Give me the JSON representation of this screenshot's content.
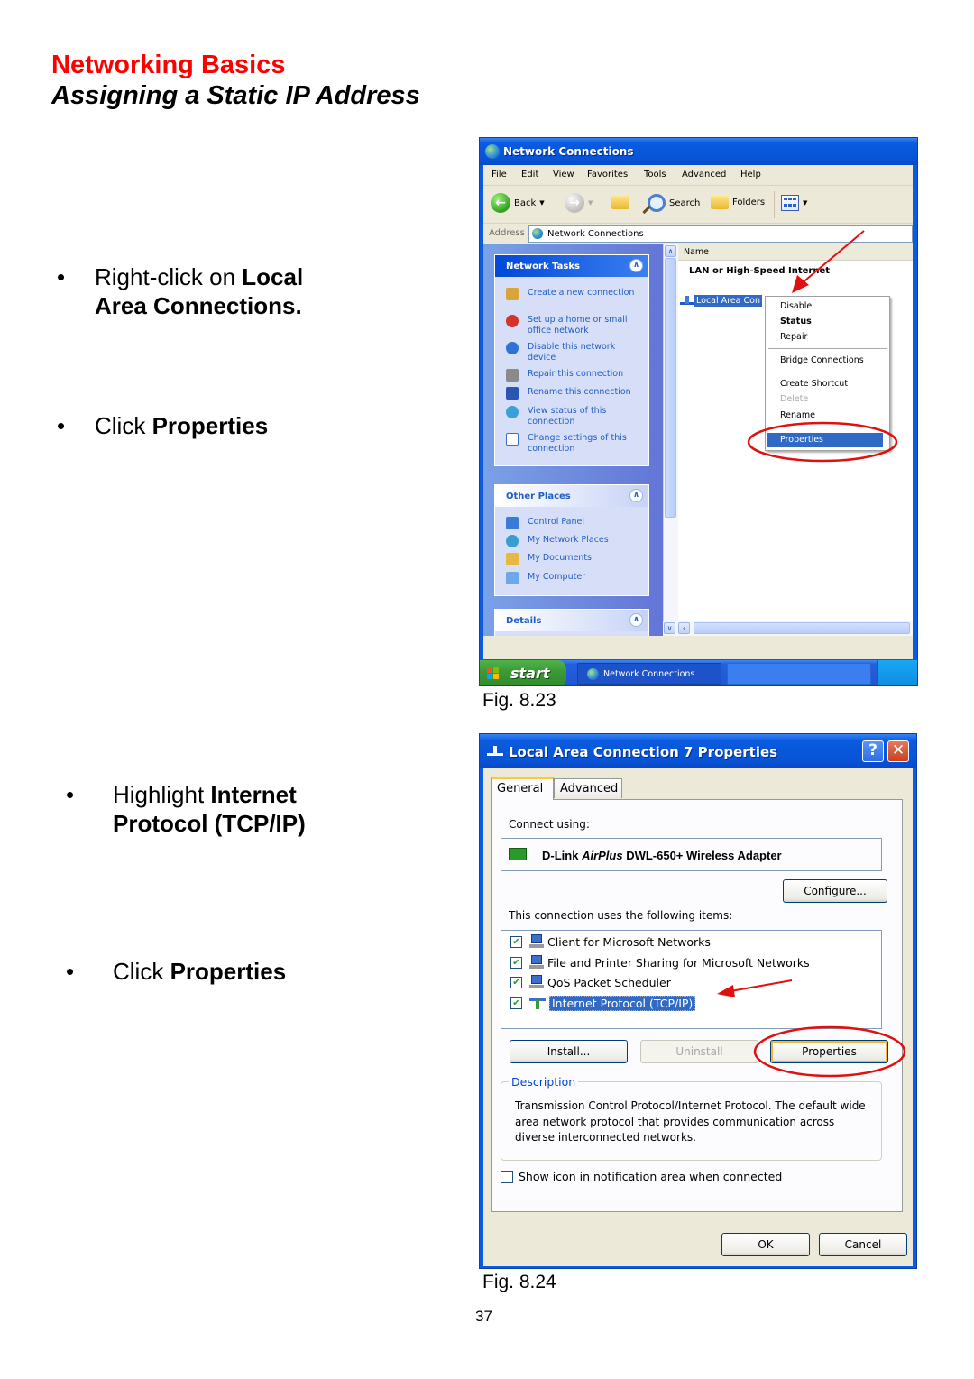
{
  "page": {
    "section": "Networking Basics",
    "title": "Assigning a Static IP Address",
    "page_number": "37",
    "accent_color": "#ff0000"
  },
  "instructions": {
    "step1": {
      "normal": "Right-click on ",
      "bold_a": "Local",
      "bold_b": "Area Connections."
    },
    "step2": {
      "normal": "Click ",
      "bold": "Properties"
    },
    "step3": {
      "normal": "Highlight ",
      "bold_a": "Internet",
      "bold_b": "Protocol (TCP/IP)"
    },
    "step4": {
      "normal": "Click ",
      "bold": "Properties"
    },
    "bullet": "•"
  },
  "fig1": {
    "caption": "Fig. 8.23",
    "window_title": "Network Connections",
    "menu": [
      "File",
      "Edit",
      "View",
      "Favorites",
      "Tools",
      "Advanced",
      "Help"
    ],
    "toolbar": {
      "back": "Back",
      "search": "Search",
      "folders": "Folders"
    },
    "address": {
      "label": "Address",
      "value": "Network Connections"
    },
    "network_tasks": {
      "title": "Network Tasks",
      "items": [
        "Create a new connection",
        "Set up a home or small office network",
        "Disable this network device",
        "Repair this connection",
        "Rename this connection",
        "View status of this connection",
        "Change settings of this connection"
      ]
    },
    "other_places": {
      "title": "Other Places",
      "items": [
        "Control Panel",
        "My Network Places",
        "My Documents",
        "My Computer"
      ]
    },
    "details": {
      "title": "Details"
    },
    "column_header": "Name",
    "group": "LAN or High-Speed Internet",
    "selected_item": "Local Area Con",
    "context_menu": {
      "items": [
        "Disable",
        "Status",
        "Repair",
        "Bridge Connections",
        "Create Shortcut",
        "Delete",
        "Rename",
        "Properties"
      ],
      "highlighted": "Properties"
    },
    "taskbar": {
      "start": "start",
      "task": "Network Connections"
    }
  },
  "fig2": {
    "caption": "Fig. 8.24",
    "dialog_title": "Local Area Connection 7 Properties",
    "help_glyph": "?",
    "close_glyph": "✕",
    "tabs": [
      "General",
      "Advanced"
    ],
    "connect_using_label": "Connect using:",
    "adapter": {
      "brand": "D-Link ",
      "series": "AirPlus",
      "model": " DWL-650+ Wireless Adapter"
    },
    "configure_button": "Configure...",
    "items_label": "This connection uses the following items:",
    "items": [
      {
        "label": "Client for Microsoft Networks",
        "checked": true
      },
      {
        "label": "File and Printer Sharing for Microsoft Networks",
        "checked": true
      },
      {
        "label": "QoS Packet Scheduler",
        "checked": true
      },
      {
        "label": "Internet Protocol (TCP/IP)",
        "checked": true,
        "selected": true
      }
    ],
    "check_glyph": "✔",
    "buttons": {
      "install": "Install...",
      "uninstall": "Uninstall",
      "properties": "Properties"
    },
    "description": {
      "legend": "Description",
      "text": "Transmission Control Protocol/Internet Protocol. The default wide area network protocol that provides communication across diverse interconnected networks."
    },
    "show_icon_label": "Show icon in notification area when connected",
    "show_icon_checked": false,
    "ok": "OK",
    "cancel": "Cancel"
  }
}
